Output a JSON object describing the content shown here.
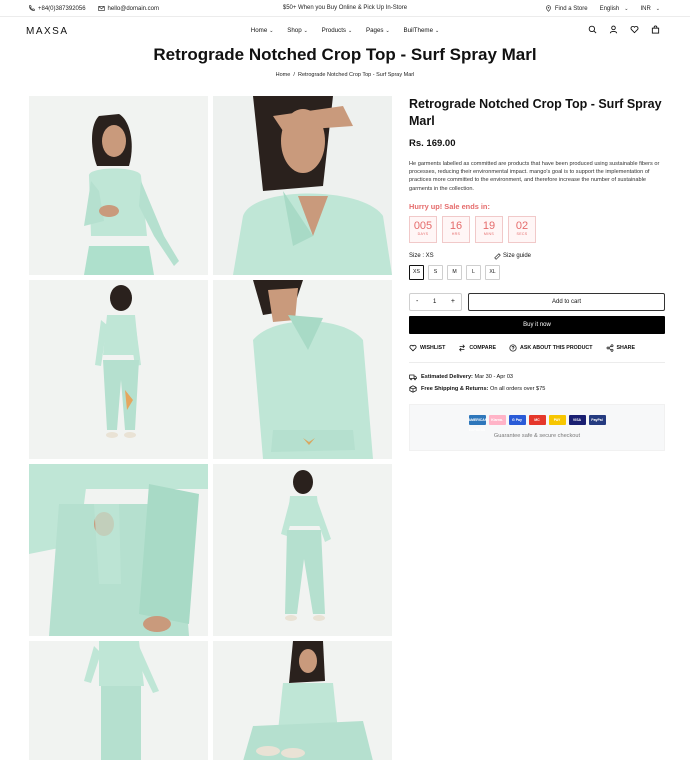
{
  "topbar": {
    "phone": "+84(0)387392056",
    "email": "hello@domain.com",
    "promo": "$50+ When you Buy Online & Pick Up In-Store",
    "find_store": "Find a Store",
    "language": "English",
    "currency": "INR"
  },
  "header": {
    "logo": "MAXSA",
    "nav": [
      "Home",
      "Shop",
      "Products",
      "Pages",
      "BuilTheme"
    ]
  },
  "page": {
    "title": "Retrograde Notched Crop Top - Surf Spray Marl",
    "breadcrumb": {
      "home": "Home",
      "sep": "/",
      "current": "Retrograde Notched Crop Top - Surf Spray Marl"
    }
  },
  "product": {
    "title": "Retrograde Notched Crop Top - Surf Spray Marl",
    "price": "Rs. 169.00",
    "description": "He garments labelled as committed are products that have been produced using sustainable fibers or processes, reducing their environmental impact. mango's goal is to support the implementation of practices more committed to the environment, and therefore increase the number of sustainable garments in the collection.",
    "hurry": "Hurry up! Sale ends in:",
    "timer": [
      {
        "value": "005",
        "label": "DAYS"
      },
      {
        "value": "16",
        "label": "HRS"
      },
      {
        "value": "19",
        "label": "MINS"
      },
      {
        "value": "02",
        "label": "SECS"
      }
    ],
    "size_label": "Size : XS",
    "size_guide": "Size guide",
    "sizes": [
      "XS",
      "S",
      "M",
      "L",
      "XL"
    ],
    "selected_size": "XS",
    "quantity": "1",
    "qty_minus": "-",
    "qty_plus": "+",
    "add_to_cart": "Add to cart",
    "buy_now": "Buy it now",
    "actions": [
      "WISHLIST",
      "COMPARE",
      "ASK ABOUT THIS PRODUCT",
      "SHARE"
    ],
    "delivery_label": "Estimated Delivery:",
    "delivery_value": "Mar 30 - Apr 03",
    "shipping_label": "Free Shipping & Returns:",
    "shipping_value": "On all orders over $75",
    "payment_cards": [
      {
        "name": "AMERICAN EXPRESS",
        "color": "#2e77bb"
      },
      {
        "name": "Klarna.",
        "color": "#ffb3c7"
      },
      {
        "name": "G Pay",
        "color": "#2a5bd7"
      },
      {
        "name": "MC",
        "color": "#e5372b"
      },
      {
        "name": "PAY",
        "color": "#f7c600"
      },
      {
        "name": "VISA",
        "color": "#1a1f71"
      },
      {
        "name": "PayPal",
        "color": "#253b80"
      }
    ],
    "guarantee": "Guarantee safe & secure checkout"
  },
  "colors": {
    "accent_sale": "#e56b6b",
    "garment": "#bfe6d6",
    "photo_bg": "#eef2ef"
  }
}
